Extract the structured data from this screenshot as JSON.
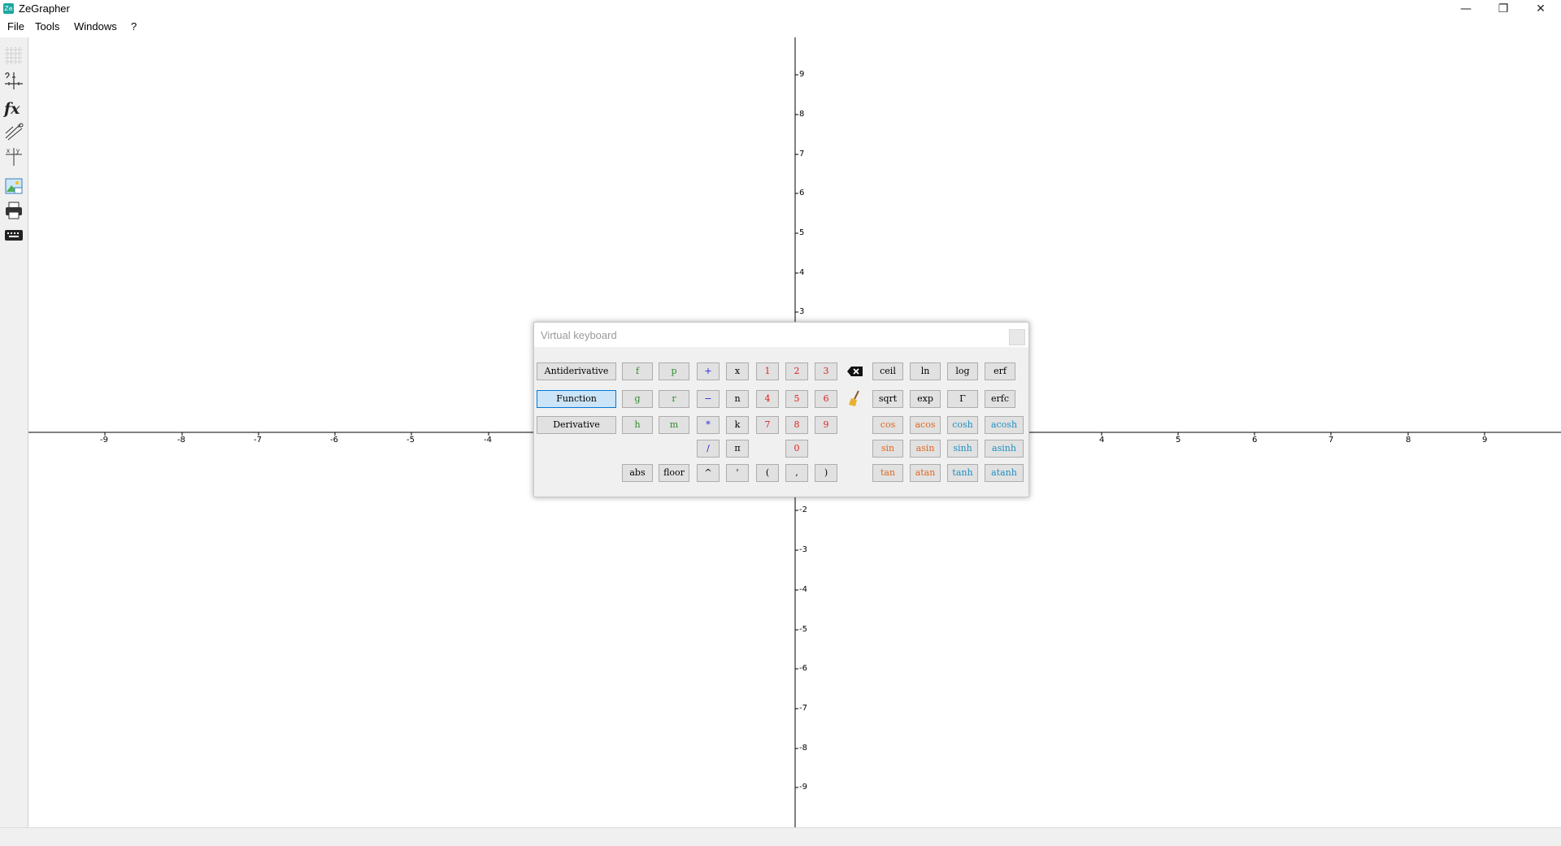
{
  "window": {
    "title": "ZeGrapher",
    "app_icon_text": "Ze",
    "minimize": "—",
    "restore": "❐",
    "close": "✕"
  },
  "menu": [
    "File",
    "Tools",
    "Windows",
    "?"
  ],
  "toolbar": [
    "grid-icon",
    "axis-settings-icon",
    "function-icon",
    "sequence-icon",
    "table-icon",
    "export-image-icon",
    "print-icon",
    "keyboard-icon"
  ],
  "graph": {
    "x_ticks": [
      "-9",
      "-8",
      "-7",
      "-6",
      "-5",
      "-4",
      "4",
      "5",
      "6",
      "7",
      "8",
      "9"
    ],
    "y_ticks_pos": [
      "9",
      "8",
      "7",
      "6",
      "5",
      "4",
      "3"
    ],
    "y_ticks_neg": [
      "-2",
      "-3",
      "-4",
      "-5",
      "-6",
      "-7",
      "-8",
      "-9"
    ]
  },
  "keyboard": {
    "title": "Virtual keyboard",
    "modes": [
      "Antiderivative",
      "Function",
      "Derivative"
    ],
    "selected_mode": "Function",
    "funcs_col1": [
      "f",
      "g",
      "h"
    ],
    "funcs_col2": [
      "p",
      "r",
      "m"
    ],
    "ops": [
      "+",
      "−",
      "*",
      "/"
    ],
    "vars": [
      "x",
      "n",
      "k",
      "π"
    ],
    "digits_row1": [
      "1",
      "2",
      "3"
    ],
    "digits_row2": [
      "4",
      "5",
      "6"
    ],
    "digits_row3": [
      "7",
      "8",
      "9"
    ],
    "digit_zero": "0",
    "bottom_row": [
      "abs",
      "floor",
      "^",
      "'",
      "(",
      ",",
      ")"
    ],
    "math_row1": [
      "ceil",
      "ln",
      "log",
      "erf"
    ],
    "math_row2": [
      "sqrt",
      "exp",
      "Γ",
      "erfc"
    ],
    "trig_row1": [
      "cos",
      "acos",
      "cosh",
      "acosh"
    ],
    "trig_row2": [
      "sin",
      "asin",
      "sinh",
      "asinh"
    ],
    "trig_row3": [
      "tan",
      "atan",
      "tanh",
      "atanh"
    ]
  },
  "colors": {
    "func_letters": "#2e8b2e",
    "operators": "#1f1fd8",
    "digits": "#e02020",
    "trig": "#e06820",
    "hyperbolic": "#1f8fc0",
    "selected_mode_bg": "#cce4f7"
  }
}
